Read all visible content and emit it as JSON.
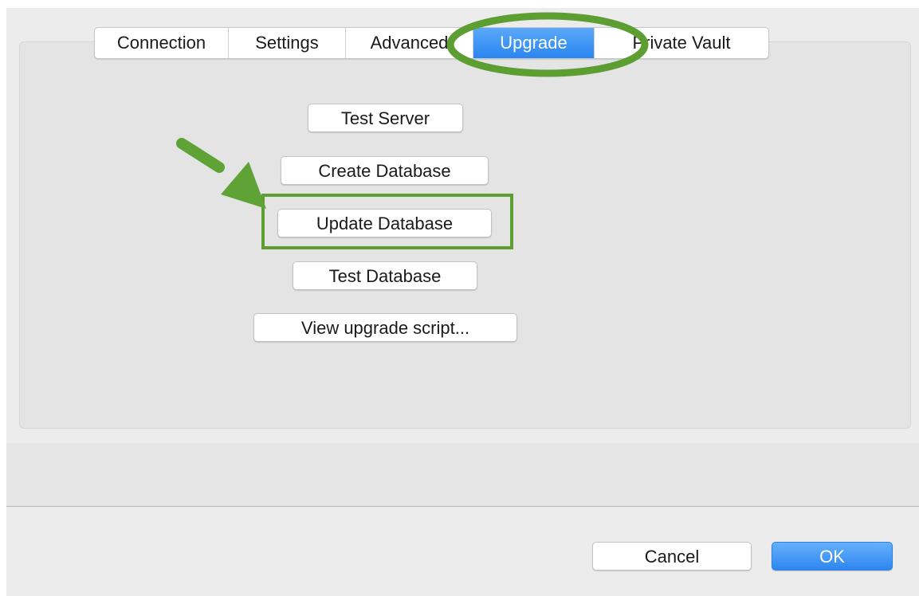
{
  "tabs": {
    "connection": "Connection",
    "settings": "Settings",
    "advanced": "Advanced",
    "upgrade": "Upgrade",
    "private_vault": "Private Vault",
    "selected": "Upgrade"
  },
  "upgrade_panel": {
    "test_server": "Test Server",
    "create_database": "Create Database",
    "update_database": "Update Database",
    "test_database": "Test Database",
    "view_upgrade_script": "View upgrade script..."
  },
  "footer": {
    "cancel": "Cancel",
    "ok": "OK"
  },
  "annotations": {
    "highlight_color": "#5c9e32",
    "arrow_color": "#5fa236",
    "tab_highlight_shape": "ellipse",
    "button_highlight_shape": "rectangle",
    "pointer_icon": "arrow"
  },
  "colors": {
    "accent_blue": "#2b86f0",
    "window_bg": "#ececec",
    "pane_bg": "#e4e4e4"
  }
}
